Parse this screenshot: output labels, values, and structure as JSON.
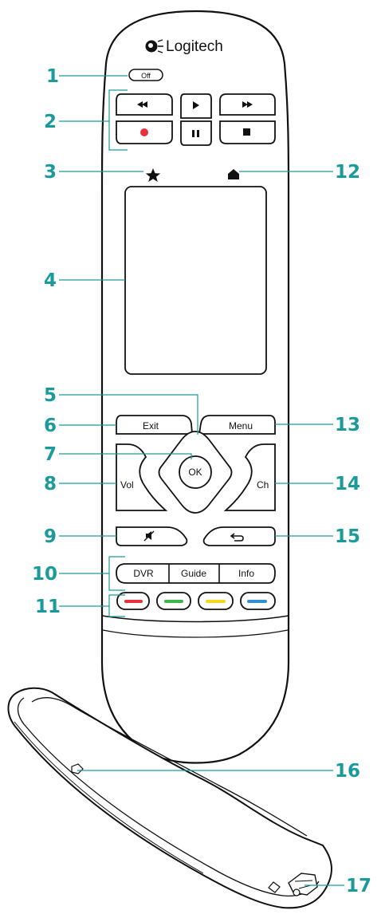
{
  "brand": {
    "name": "Logitech"
  },
  "colors": {
    "callout": "#1a9a9a",
    "outline": "#111111",
    "record": "#e8303a",
    "red": "#e8303a",
    "green": "#3cb44a",
    "yellow": "#f7d51d",
    "blue": "#2f8fd0"
  },
  "buttons": {
    "off": "Off",
    "exit": "Exit",
    "menu": "Menu",
    "vol": "Vol",
    "ch": "Ch",
    "ok": "OK",
    "dvr": "DVR",
    "guide": "Guide",
    "info": "Info"
  },
  "icons": {
    "rewind": "rewind-icon",
    "play": "play-icon",
    "fast_forward": "fast-forward-icon",
    "record": "record-icon",
    "pause": "pause-icon",
    "stop": "stop-icon",
    "favorite": "star-icon",
    "home": "home-icon",
    "mute": "mute-icon",
    "back": "back-icon"
  },
  "callouts": [
    "1",
    "2",
    "3",
    "4",
    "5",
    "6",
    "7",
    "8",
    "9",
    "10",
    "11",
    "12",
    "13",
    "14",
    "15",
    "16",
    "17"
  ]
}
